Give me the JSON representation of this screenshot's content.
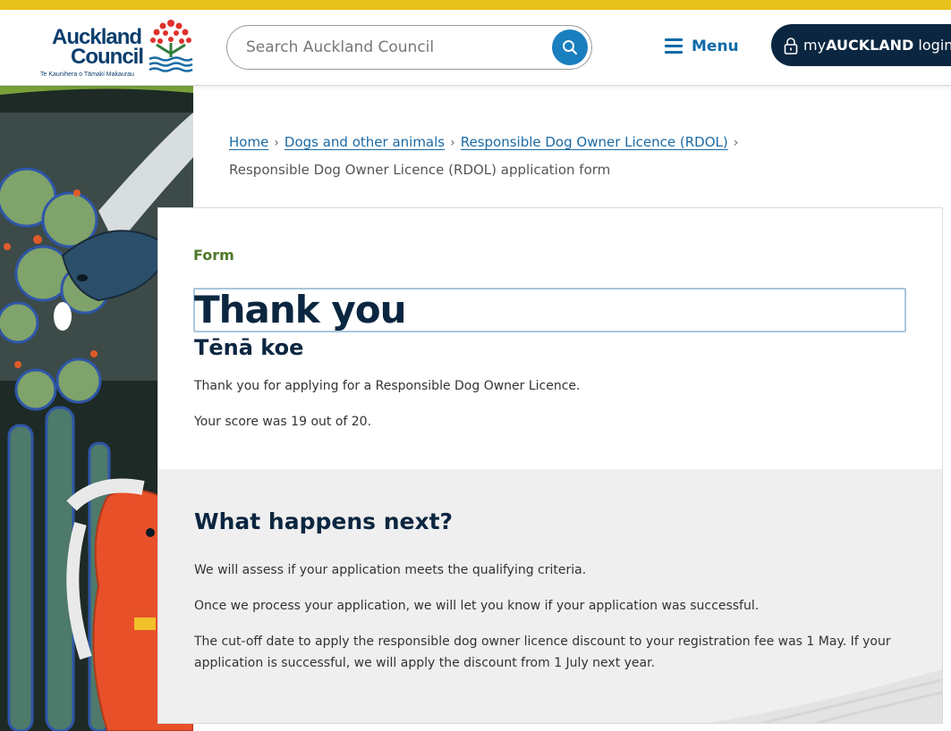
{
  "header": {
    "logo": {
      "line1": "Auckland",
      "line2": "Council",
      "tagline": "Te Kaunihera o Tāmaki Makaurau"
    },
    "search": {
      "placeholder": "Search Auckland Council",
      "button_icon": "search-icon"
    },
    "menu_label": "Menu",
    "login": {
      "prefix": "my",
      "brand": "AUCKLAND",
      "suffix": " login",
      "icon": "lock-icon"
    }
  },
  "breadcrumb": {
    "items": [
      "Home",
      "Dogs and other animals",
      "Responsible Dog Owner Licence (RDOL)"
    ],
    "current": "Responsible Dog Owner Licence (RDOL) application form"
  },
  "form": {
    "kicker": "Form",
    "title": "Thank you",
    "subtitle": "Tēnā koe",
    "message": "Thank you for applying for a Responsible Dog Owner Licence.",
    "score": "Your score was 19 out of 20."
  },
  "next_steps": {
    "title": "What happens next?",
    "paragraphs": [
      "We will assess if your application meets the qualifying criteria.",
      "Once we process your application, we will let you know if your application was successful.",
      "The cut-off date to apply the responsible dog owner licence discount to your registration fee was 1 May. If your application is successful, we will apply the discount from 1 July next year."
    ]
  },
  "colors": {
    "accent_bar": "#e8c21c",
    "brand_navy": "#0b2640",
    "link_blue": "#1a6aa5",
    "kicker_green": "#4d7a2a"
  }
}
